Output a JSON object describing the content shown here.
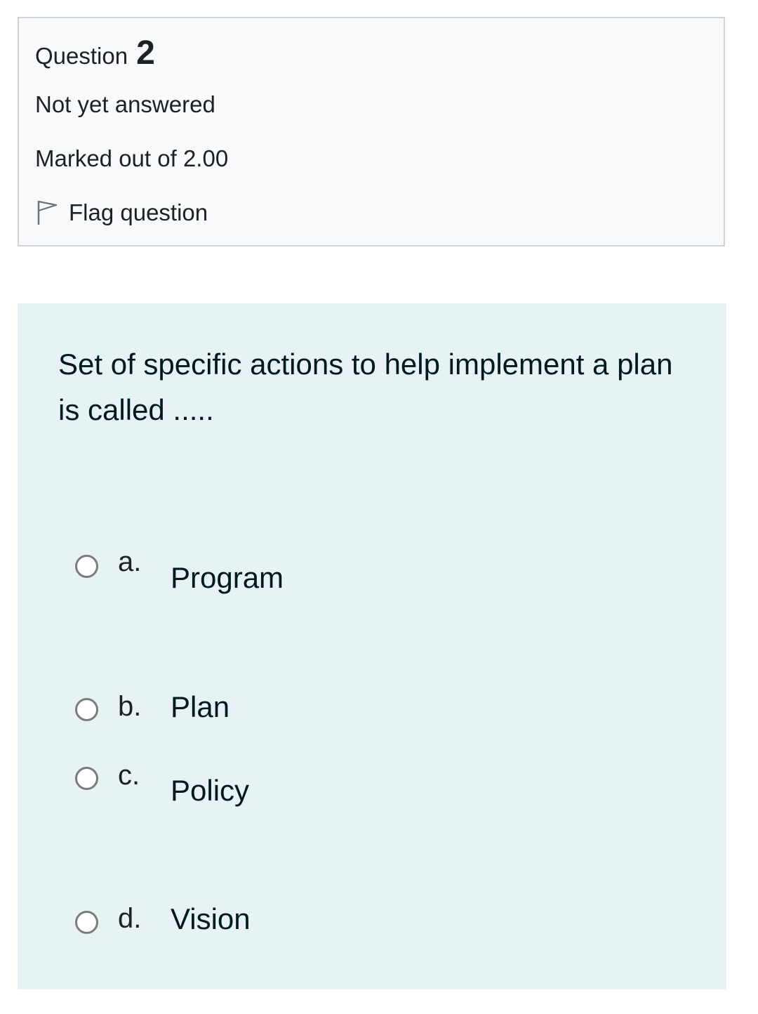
{
  "info": {
    "question_label": "Question",
    "question_number": "2",
    "state": "Not yet answered",
    "grade": "Marked out of 2.00",
    "flag_label": "Flag question",
    "flag_icon": "flag-outline-icon"
  },
  "question": {
    "text": "Set of specific actions to help implement a plan is called .....",
    "options": [
      {
        "letter": "a.",
        "text": "Program",
        "selected": false
      },
      {
        "letter": "b.",
        "text": "Plan",
        "selected": false
      },
      {
        "letter": "c.",
        "text": "Policy",
        "selected": false
      },
      {
        "letter": "d.",
        "text": "Vision",
        "selected": false
      }
    ]
  },
  "colors": {
    "info_background": "#f8f9fa",
    "info_border": "#cfd4da",
    "content_background": "#e7f2f5",
    "text": "#1d2125",
    "radio_border": "#7b7b7b"
  }
}
